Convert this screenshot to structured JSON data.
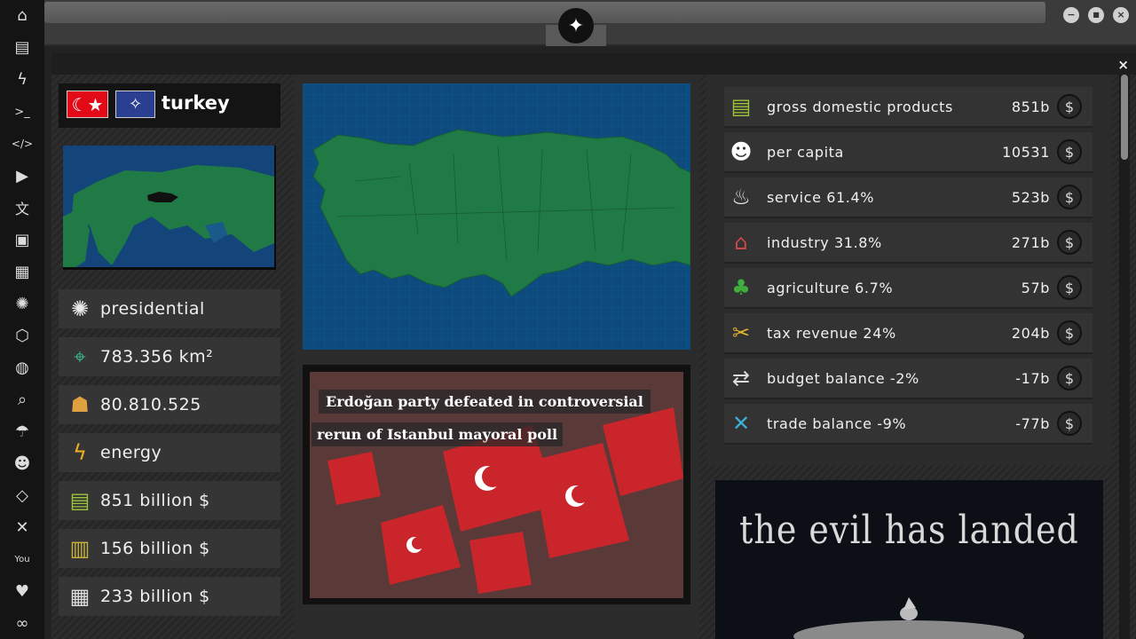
{
  "sidebar": {
    "items": [
      {
        "icon": "home-icon",
        "glyph": "⌂"
      },
      {
        "icon": "document-icon",
        "glyph": "▤"
      },
      {
        "icon": "lightning-icon",
        "glyph": "ϟ"
      },
      {
        "icon": "terminal-icon",
        "glyph": ">_"
      },
      {
        "icon": "code-icon",
        "glyph": "</>"
      },
      {
        "icon": "play-icon",
        "glyph": "▶"
      },
      {
        "icon": "translate-icon",
        "glyph": "文"
      },
      {
        "icon": "image-icon",
        "glyph": "▣"
      },
      {
        "icon": "news-icon",
        "glyph": "▦"
      },
      {
        "icon": "empire-icon",
        "glyph": "✺"
      },
      {
        "icon": "hexagon-icon",
        "glyph": "⬡"
      },
      {
        "icon": "globe-icon",
        "glyph": "◍"
      },
      {
        "icon": "search-icon",
        "glyph": "⌕"
      },
      {
        "icon": "umbrella-icon",
        "glyph": "☂"
      },
      {
        "icon": "contact-icon",
        "glyph": "☻"
      },
      {
        "icon": "diamond-code-icon",
        "glyph": "◇"
      },
      {
        "icon": "crossed-tools-icon",
        "glyph": "✕"
      },
      {
        "icon": "youtube-icon",
        "glyph": "You"
      },
      {
        "icon": "heart-icon",
        "glyph": "♥"
      },
      {
        "icon": "infinity-icon",
        "glyph": "∞"
      }
    ]
  },
  "header": {
    "logo_icon": "rebel-alliance-icon",
    "logo_glyph": "✦",
    "minimize_glyph": "−",
    "maximize_glyph": "■",
    "close_glyph": "×"
  },
  "panel": {
    "close_glyph": "×"
  },
  "country": {
    "name": "turkey",
    "flag_glyph": "☾★",
    "alliance_glyph": "✧"
  },
  "info": [
    {
      "icon": "empire-emblem-icon",
      "glyph": "✺",
      "text": "presidential"
    },
    {
      "icon": "map-pin-icon",
      "glyph": "⌖",
      "text": "783.356 km²"
    },
    {
      "icon": "population-icon",
      "glyph": "☗",
      "text": "80.810.525"
    },
    {
      "icon": "energy-icon",
      "glyph": "ϟ",
      "text": "energy"
    },
    {
      "icon": "money-stack-icon",
      "glyph": "▤",
      "text": "851 billion $"
    },
    {
      "icon": "money-cart-icon",
      "glyph": "▥",
      "text": "156 billion $"
    },
    {
      "icon": "shipping-box-icon",
      "glyph": "▦",
      "text": "233 billion $"
    }
  ],
  "news": {
    "headline_line1": "Erdoğan party defeated in controversial",
    "headline_line2": "rerun of Istanbul mayoral poll"
  },
  "economy": [
    {
      "icon": "money-stack-icon",
      "glyph": "▤",
      "label": "gross domestic products",
      "value": "851b"
    },
    {
      "icon": "person-icon",
      "glyph": "☻",
      "label": "per capita",
      "value": "10531"
    },
    {
      "icon": "chef-icon",
      "glyph": "♨",
      "label": "service 61.4%",
      "value": "523b"
    },
    {
      "icon": "factory-icon",
      "glyph": "⌂",
      "label": "industry 31.8%",
      "value": "271b"
    },
    {
      "icon": "sprout-icon",
      "glyph": "♣",
      "label": "agriculture 6.7%",
      "value": "57b"
    },
    {
      "icon": "scissors-money-icon",
      "glyph": "✂",
      "label": "tax revenue 24%",
      "value": "204b"
    },
    {
      "icon": "exchange-arrows-icon",
      "glyph": "⇄",
      "label": "budget balance -2%",
      "value": "-17b"
    },
    {
      "icon": "trade-cross-icon",
      "glyph": "✕",
      "label": "trade balance -9%",
      "value": "-77b"
    }
  ],
  "currency_glyph": "$",
  "promo": {
    "text": "the evil has landed"
  }
}
